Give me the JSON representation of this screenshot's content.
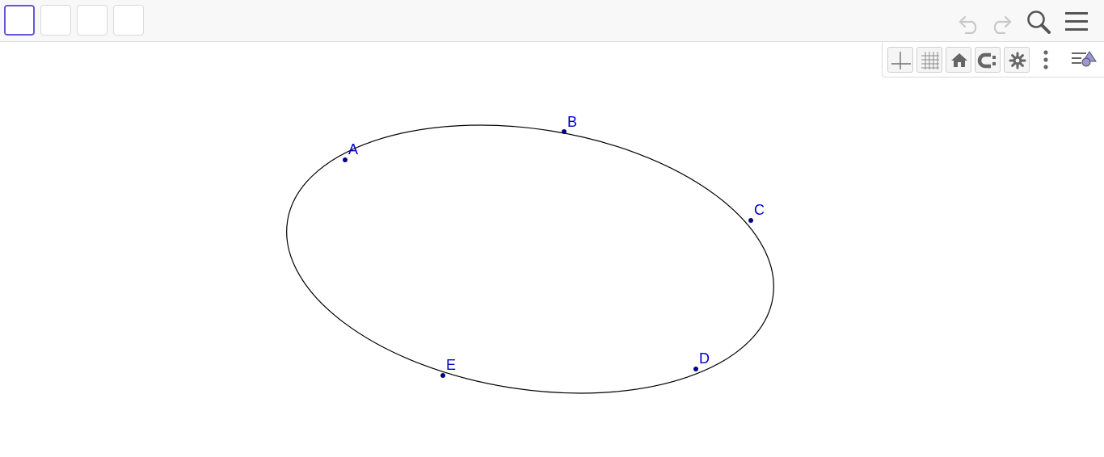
{
  "toolbar": {
    "tools": [
      {
        "name": "tool-1",
        "selected": true
      },
      {
        "name": "tool-2",
        "selected": false
      },
      {
        "name": "tool-3",
        "selected": false
      },
      {
        "name": "tool-4",
        "selected": false
      }
    ],
    "icons": [
      "undo-icon",
      "redo-icon",
      "search-icon",
      "menu-icon"
    ]
  },
  "graphics_bar": {
    "icons": [
      "axes-icon",
      "grid-icon",
      "home-icon",
      "point-capturing-icon",
      "settings-icon",
      "more-icon",
      "style-bar-toggle-icon"
    ]
  },
  "construction": {
    "curve": "ellipse",
    "points": [
      {
        "label": "A"
      },
      {
        "label": "B"
      },
      {
        "label": "C"
      },
      {
        "label": "D"
      },
      {
        "label": "E"
      }
    ]
  },
  "colors": {
    "point": "#00007f",
    "label": "#0000cc",
    "curve": "#000000",
    "selected_tool_border": "#6557d2",
    "disabled_icon": "#c8c8c8",
    "icon": "#555555"
  }
}
